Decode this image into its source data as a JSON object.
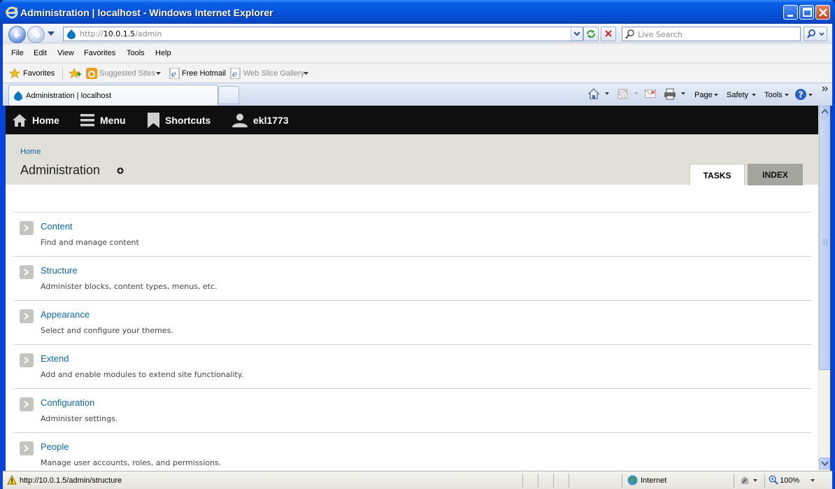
{
  "window": {
    "title": "Administration  |  localhost - Windows Internet Explorer"
  },
  "address": {
    "scheme": "http://",
    "host": "10.0.1.5",
    "path": "/admin"
  },
  "search": {
    "placeholder": "Live Search"
  },
  "menu": [
    "File",
    "Edit",
    "View",
    "Favorites",
    "Tools",
    "Help"
  ],
  "favorites_bar": {
    "favorites_label": "Favorites",
    "suggested_sites": "Suggested Sites",
    "free_hotmail": "Free Hotmail",
    "web_slice_gallery": "Web Slice Gallery"
  },
  "browser_tab": {
    "label": "Administration | localhost"
  },
  "command_bar": {
    "page": "Page",
    "safety": "Safety",
    "tools": "Tools"
  },
  "toolbar": {
    "home": "Home",
    "menu": "Menu",
    "shortcuts": "Shortcuts",
    "user": "ekl1773"
  },
  "header": {
    "breadcrumb": "Home",
    "title": "Administration",
    "tabs": {
      "tasks": "TASKS",
      "index": "INDEX"
    }
  },
  "items": [
    {
      "title": "Content",
      "desc": "Find and manage content"
    },
    {
      "title": "Structure",
      "desc": "Administer blocks, content types, menus, etc."
    },
    {
      "title": "Appearance",
      "desc": "Select and configure your themes."
    },
    {
      "title": "Extend",
      "desc": "Add and enable modules to extend site functionality."
    },
    {
      "title": "Configuration",
      "desc": "Administer settings."
    },
    {
      "title": "People",
      "desc": "Manage user accounts, roles, and permissions."
    }
  ],
  "status": {
    "url": "http://10.0.1.5/admin/structure",
    "zone": "Internet",
    "zoom": "100%"
  },
  "colors": {
    "link": "#0b68a8",
    "toolbar_bg": "#0f0f0f",
    "header_bg": "#e0e0d8",
    "xp_title_blue": "#0553dd"
  }
}
